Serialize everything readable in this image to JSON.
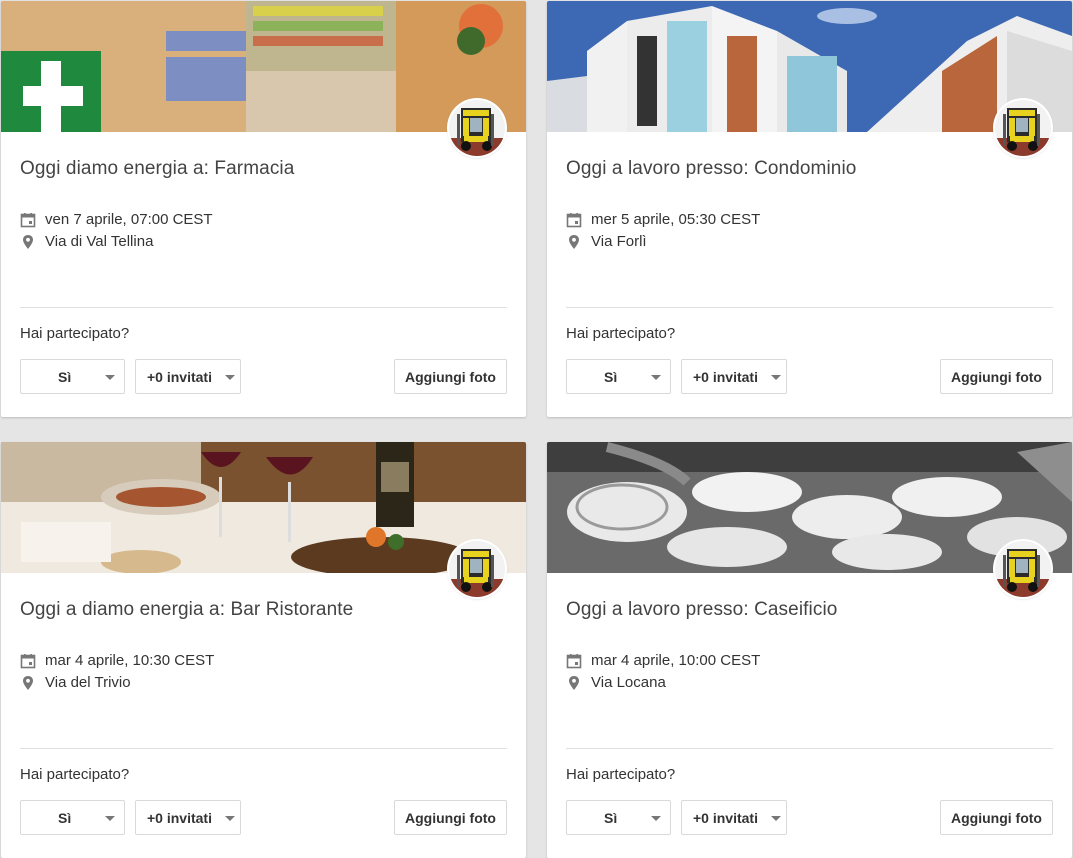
{
  "colors": {
    "background": "#e5e5e5",
    "card": "#ffffff",
    "title_text": "#444444",
    "icon": "#777777",
    "divider": "#e0e0e0"
  },
  "events": [
    {
      "title": "Oggi diamo energia a: Farmacia",
      "date": "ven 7 aprile, 07:00 CEST",
      "location": "Via di Val Tellina",
      "question": "Hai partecipato?",
      "rsvp": "Sì",
      "guests": "+0 invitati",
      "add_photo": "Aggiungi foto",
      "cover": "pharmacy-interior",
      "avatar": "forklift-avatar"
    },
    {
      "title": "Oggi a lavoro presso: Condominio",
      "date": "mer 5 aprile, 05:30 CEST",
      "location": "Via Forlì",
      "question": "Hai partecipato?",
      "rsvp": "Sì",
      "guests": "+0 invitati",
      "add_photo": "Aggiungi foto",
      "cover": "apartment-building",
      "avatar": "forklift-avatar"
    },
    {
      "title": "Oggi a diamo energia a: Bar Ristorante",
      "date": "mar 4 aprile, 10:30 CEST",
      "location": "Via del Trivio",
      "question": "Hai partecipato?",
      "rsvp": "Sì",
      "guests": "+0 invitati",
      "add_photo": "Aggiungi foto",
      "cover": "restaurant-table",
      "avatar": "forklift-avatar"
    },
    {
      "title": "Oggi a lavoro presso: Caseificio",
      "date": "mar 4 aprile, 10:00 CEST",
      "location": "Via Locana",
      "question": "Hai partecipato?",
      "rsvp": "Sì",
      "guests": "+0 invitati",
      "add_photo": "Aggiungi foto",
      "cover": "cheese-factory",
      "avatar": "forklift-avatar"
    }
  ]
}
